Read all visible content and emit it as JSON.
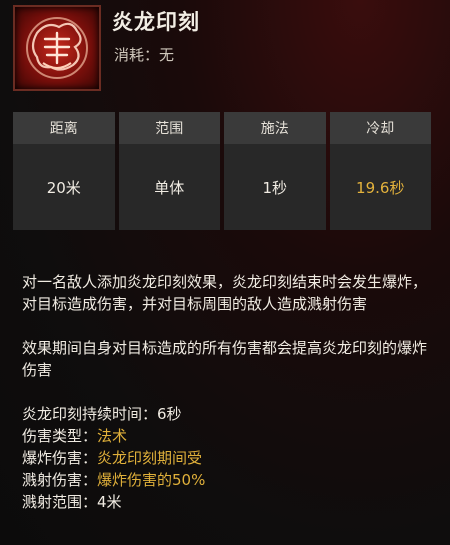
{
  "skill": {
    "name": "炎龙印刻",
    "cost_label": "消耗：",
    "cost_value": "无",
    "icon": "dragon-seal-icon"
  },
  "stats": {
    "headers": [
      "距离",
      "范围",
      "施法",
      "冷却"
    ],
    "values": [
      "20米",
      "单体",
      "1秒",
      "19.6秒"
    ]
  },
  "description": {
    "paragraphs": [
      "对一名敌人添加炎龙印刻效果，炎龙印刻结束时会发生爆炸，对目标造成伤害，并对目标周围的敌人造成溅射伤害",
      "效果期间自身对目标造成的所有伤害都会提高炎龙印刻的爆炸伤害"
    ],
    "attributes": [
      {
        "label": "炎龙印刻持续时间：",
        "value": "6秒"
      },
      {
        "label": "伤害类型：",
        "value": "法术"
      },
      {
        "label": "爆炸伤害：",
        "value": "炎龙印刻期间受"
      },
      {
        "label": "溅射伤害：",
        "value": "爆炸伤害的50%"
      },
      {
        "label": "溅射范围：",
        "value": "4米"
      }
    ]
  },
  "colors": {
    "highlight": "#e0b03a",
    "cooldown": "#e3b23c",
    "icon_red": "#c4281c"
  }
}
